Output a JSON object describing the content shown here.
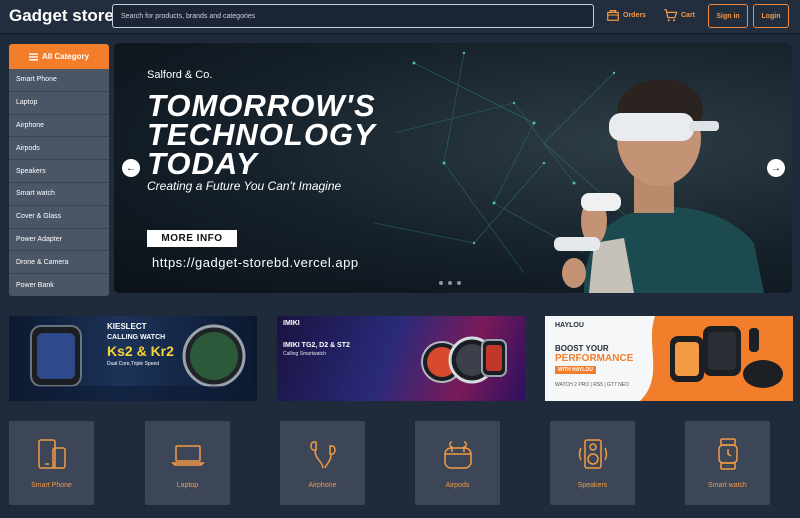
{
  "header": {
    "logo": "Gadget store",
    "search_placeholder": "Search for products, brands and categories",
    "orders_label": "Orders",
    "cart_label": "Cart",
    "signin_label": "Sign in",
    "login_label": "Login"
  },
  "sidebar": {
    "title": "All Category",
    "items": [
      "Smart Phone",
      "Laptop",
      "Airphone",
      "Airpods",
      "Speakers",
      "Smart watch",
      "Cover & Glass",
      "Power Adapter",
      "Drone & Camera",
      "Power Bank"
    ]
  },
  "hero": {
    "brand": "Salford & Co.",
    "title_line1": "TOMORROW'S",
    "title_line2": "TECHNOLOGY",
    "title_line3": "TODAY",
    "subtitle": "Creating a Future You Can't Imagine",
    "button": "MORE INFO",
    "url": "https://gadget-storebd.vercel.app",
    "prev_icon": "chevron-left-icon",
    "next_icon": "chevron-right-icon"
  },
  "promos": [
    {
      "brand": "KIESLECT",
      "line1": "CALLING WATCH",
      "line2": "Ks2 & Kr2",
      "line3": "Dual Core,Triple Speed"
    },
    {
      "brand": "IMIKI",
      "line1": "IMIKI TG2, D2 & ST2",
      "line2": "Calling Smartwatch"
    },
    {
      "brand": "HAYLOU",
      "line1": "BOOST YOUR",
      "line2": "PERFORMANCE",
      "line3": "WITH HAYLOU",
      "line4": "WATCH 2 PRO | RS5 | GT7 NEO"
    }
  ],
  "categories": [
    {
      "label": "Smart Phone",
      "icon": "smartphone-icon"
    },
    {
      "label": "Laptop",
      "icon": "laptop-icon"
    },
    {
      "label": "Airphone",
      "icon": "earphone-icon"
    },
    {
      "label": "Airpods",
      "icon": "airpods-icon"
    },
    {
      "label": "Speakers",
      "icon": "speaker-icon"
    },
    {
      "label": "Smart watch",
      "icon": "smartwatch-icon"
    }
  ],
  "colors": {
    "accent": "#f27e2b",
    "background": "#1f2a3a",
    "tile": "#3c4656"
  }
}
